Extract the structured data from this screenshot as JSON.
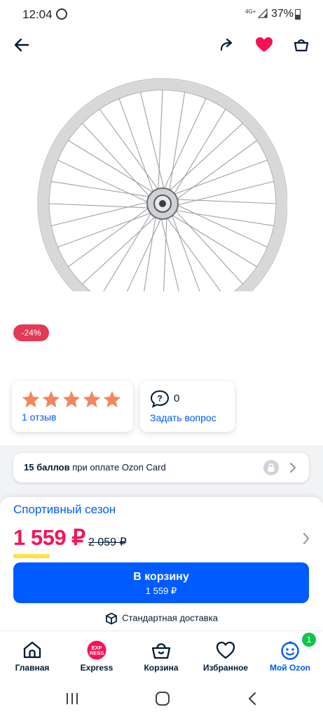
{
  "status_bar": {
    "time": "12:04",
    "network": "4G+",
    "battery": "37%"
  },
  "top_bar": {
    "back_icon": "arrow-left-icon",
    "share_icon": "share-icon",
    "favorite_icon": "heart-icon",
    "favorite_color": "#f91155",
    "cart_icon": "shopping-bag-icon"
  },
  "product": {
    "image": "bicycle-wheel-image",
    "discount_badge": "-24%"
  },
  "rating": {
    "stars": 5,
    "reviews_label": "1 отзыв"
  },
  "questions": {
    "count": "0",
    "ask_label": "Задать вопрос"
  },
  "bonus": {
    "points": "15 баллов",
    "text": " при оплате Ozon Card"
  },
  "promo": {
    "season_label": "Спортивный сезон"
  },
  "price": {
    "current": "1 559 ₽",
    "old": "2 059 ₽",
    "price_color": "#f91155"
  },
  "cart_button": {
    "label": "В корзину",
    "price": "1 559 ₽",
    "color": "#005bff"
  },
  "delivery": {
    "label": "Стандартная доставка"
  },
  "bottom_nav": {
    "items": [
      {
        "label": "Главная",
        "icon": "home-icon"
      },
      {
        "label": "Express",
        "icon": "express-icon"
      },
      {
        "label": "Корзина",
        "icon": "cart-icon"
      },
      {
        "label": "Избранное",
        "icon": "heart-icon"
      },
      {
        "label": "Мой Ozon",
        "icon": "profile-smile-icon",
        "active": true
      }
    ],
    "notification_count": "1"
  },
  "express_logo": {
    "top": "EXP",
    "bottom": "RESS"
  }
}
